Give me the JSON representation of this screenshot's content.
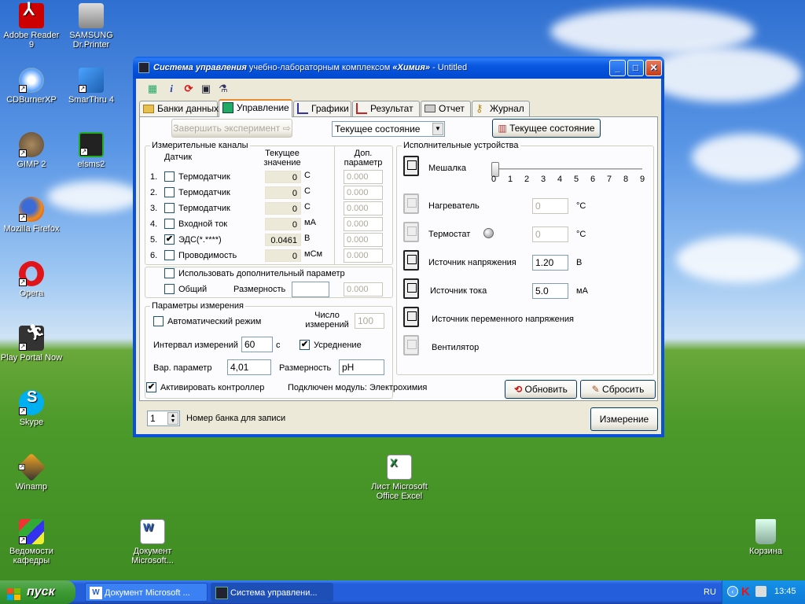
{
  "desktop": {
    "icons": [
      {
        "name": "adobe-reader-icon",
        "label": "Adobe Reader 9"
      },
      {
        "name": "samsung-printer-icon",
        "label": "SAMSUNG Dr.Printer"
      },
      {
        "name": "cdburnerxp-icon",
        "label": "CDBurnerXP"
      },
      {
        "name": "smarthru-icon",
        "label": "SmarThru 4"
      },
      {
        "name": "gimp-icon",
        "label": "GIMP 2"
      },
      {
        "name": "elsms2-icon",
        "label": "elsms2"
      },
      {
        "name": "firefox-icon",
        "label": "Mozilla Firefox"
      },
      {
        "name": "opera-icon",
        "label": "Opera"
      },
      {
        "name": "play-portal-icon",
        "label": "Play Portal Now"
      },
      {
        "name": "skype-icon",
        "label": "Skype"
      },
      {
        "name": "winamp-icon",
        "label": "Winamp"
      },
      {
        "name": "vedomosti-icon",
        "label": "Ведомости кафедры"
      },
      {
        "name": "word-document-icon",
        "label": "Документ Microsoft..."
      },
      {
        "name": "excel-sheet-icon",
        "label": "Лист Microsoft Office Excel"
      },
      {
        "name": "recycle-bin-icon",
        "label": "Корзина"
      }
    ]
  },
  "taskbar": {
    "start_label": "пуск",
    "tasks": [
      {
        "label": "Документ Microsoft ..."
      },
      {
        "label": "Система управлени..."
      }
    ],
    "lang": "RU",
    "clock": "13:45"
  },
  "window": {
    "title_italic": "Система управления",
    "title_rest": " учебно-лабораторным комплексом ",
    "title_brand": "«Химия»",
    "title_suffix": " - Untitled",
    "tabs": [
      {
        "label": "Банки данных"
      },
      {
        "label": "Управление"
      },
      {
        "label": "Графики"
      },
      {
        "label": "Результат"
      },
      {
        "label": "Отчет"
      },
      {
        "label": "Журнал"
      }
    ],
    "finish_button": "Завершить эксперимент",
    "state_select": "Текущее состояние",
    "state_button": "Текущее состояние",
    "channels": {
      "title": "Измерительные каналы",
      "col_sensor": "Датчик",
      "col_current": "Текущее значение",
      "col_extra": "Доп. параметр",
      "rows": [
        {
          "num": "1.",
          "name": "Термодатчик",
          "value": "0",
          "unit": "C",
          "extra": "0.000",
          "checked": ""
        },
        {
          "num": "2.",
          "name": "Термодатчик",
          "value": "0",
          "unit": "C",
          "extra": "0.000",
          "checked": ""
        },
        {
          "num": "3.",
          "name": "Термодатчик",
          "value": "0",
          "unit": "C",
          "extra": "0.000",
          "checked": ""
        },
        {
          "num": "4.",
          "name": "Входной ток",
          "value": "0",
          "unit": "мА",
          "extra": "0.000",
          "checked": ""
        },
        {
          "num": "5.",
          "name": "ЭДС(*.****)",
          "value": "0.0461",
          "unit": "В",
          "extra": "0.000",
          "checked": "✔"
        },
        {
          "num": "6.",
          "name": "Проводимость",
          "value": "0",
          "unit": "мСм",
          "extra": "0.000",
          "checked": ""
        }
      ],
      "use_extra": "Использовать дополнительный параметр",
      "common": "Общий",
      "dimension_label": "Размерность",
      "common_value": "0.000"
    },
    "measure": {
      "title": "Параметры измерения",
      "auto_mode": "Автоматический режим",
      "count_label": "Число измерений",
      "count_value": "100",
      "interval_label": "Интервал измерений",
      "interval_value": "60",
      "interval_unit": "с",
      "averaging": "Усреднение",
      "var_param_label": "Вар. параметр",
      "var_param_value": "4,01",
      "dimension_label": "Размерность",
      "dimension_value": "pH"
    },
    "devices": {
      "title": "Исполнительные устройства",
      "mixer": "Мешалка",
      "mixer_ticks": [
        "0",
        "1",
        "2",
        "3",
        "4",
        "5",
        "6",
        "7",
        "8",
        "9"
      ],
      "mixer_level": 0,
      "heater": "Нагреватель",
      "heater_value": "0",
      "heater_unit": "°C",
      "thermostat": "Термостат",
      "thermostat_value": "0",
      "thermostat_unit": "°C",
      "voltage_source": "Источник напряжения",
      "voltage_value": "1.20",
      "voltage_unit": "В",
      "current_source": "Источник тока",
      "current_value": "5.0",
      "current_unit": "мА",
      "ac_source": "Источник переменного напряжения",
      "fan": "Вентилятор"
    },
    "activate_controller": "Активировать контроллер",
    "module_label": "Подключен модуль: Электрохимия",
    "refresh_button": "Обновить",
    "reset_button": "Сбросить",
    "bank_number": "1",
    "bank_label": "Номер банка для записи",
    "measure_button": "Измерение"
  },
  "colors": {
    "xp_blue": "#0a50d8",
    "start_green": "#3c9a33",
    "window_bg": "#ece9d8"
  }
}
